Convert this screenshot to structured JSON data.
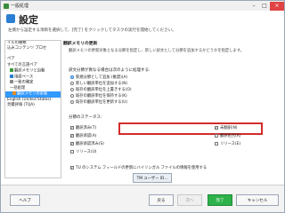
{
  "window": {
    "title": "一般処理",
    "controls": [
      "–",
      "□",
      "×"
    ]
  },
  "header": {
    "title": "設定",
    "subtitle": "左側から設定する項目を選択して、[完了] をクリックしてタスクの実行を開始してください。"
  },
  "left_pane": {
    "items": [
      {
        "label": "イルの種類",
        "icon": "none",
        "selected": false
      },
      {
        "label": "込みコンテンツ プロセ",
        "icon": "none",
        "selected": false
      },
      {
        "label": "ペア",
        "icon": "none",
        "selected": false
      },
      {
        "label": "すべての言語ペア",
        "icon": "none",
        "selected": false
      },
      {
        "label": "翻訳メモリと自動",
        "icon": "green",
        "selected": false
      },
      {
        "label": "用語ベース",
        "icon": "blue",
        "selected": false
      },
      {
        "label": "一致の確定",
        "icon": "gray",
        "selected": false
      },
      {
        "label": "一括処理",
        "icon": "none",
        "selected": false
      },
      {
        "label": "翻訳メモリの更新",
        "icon": "orange",
        "selected": true
      },
      {
        "label": "English (United States)-",
        "icon": "none",
        "selected": false
      },
      {
        "label": "見積評価 (TQA)",
        "icon": "none",
        "selected": false
      }
    ]
  },
  "right_pane": {
    "section_title": "翻訳メモリの更新",
    "section_desc": "翻訳メモリの更新対象となる分節を指定し、新しい訳文として分節を追加するかどうかを指定します。",
    "update_group_title": "訳文分節が異なる場合は次のように処理する:",
    "radio_options": [
      {
        "label": "新規分節として追加 (推奨)(A)",
        "selected": true
      },
      {
        "label": "新しい翻訳単位を追加する(N)",
        "selected": false
      },
      {
        "label": "既存の翻訳単位を上書きする(O)",
        "selected": false
      },
      {
        "label": "既存の翻訳単位を保持する(K)",
        "selected": false
      },
      {
        "label": "既存の翻訳単位を更新する(U)",
        "selected": false
      }
    ],
    "status_title": "分節のステータス:",
    "status_checkboxes": [
      {
        "label": "翻訳済み(T)",
        "checked": true
      },
      {
        "label": "未翻訳(N)",
        "checked": true
      },
      {
        "label": "翻訳承認(A)",
        "checked": true
      },
      {
        "label": "翻訳拒否(R)",
        "checked": false
      },
      {
        "label": "翻訳承認済み(S)",
        "checked": true
      },
      {
        "label": "リリース(E)",
        "checked": false
      },
      {
        "label": "リリース(U)",
        "checked": false
      }
    ],
    "tm_option_label": "TU のシステム フィールドの更新にバイリンガル ファイルの情報を使用する",
    "tm_option_checked": true,
    "tm_users_button": "TM ユーザー ID..."
  },
  "footer": {
    "help": "ヘルプ",
    "back": "戻る",
    "next": "次へ",
    "finish": "完了",
    "cancel": "キャンセル"
  },
  "colors": {
    "accent": "#2b7fd3",
    "highlight_border": "#d42b2b",
    "finish_button": "#2db24a",
    "selection": "#3399ff"
  }
}
